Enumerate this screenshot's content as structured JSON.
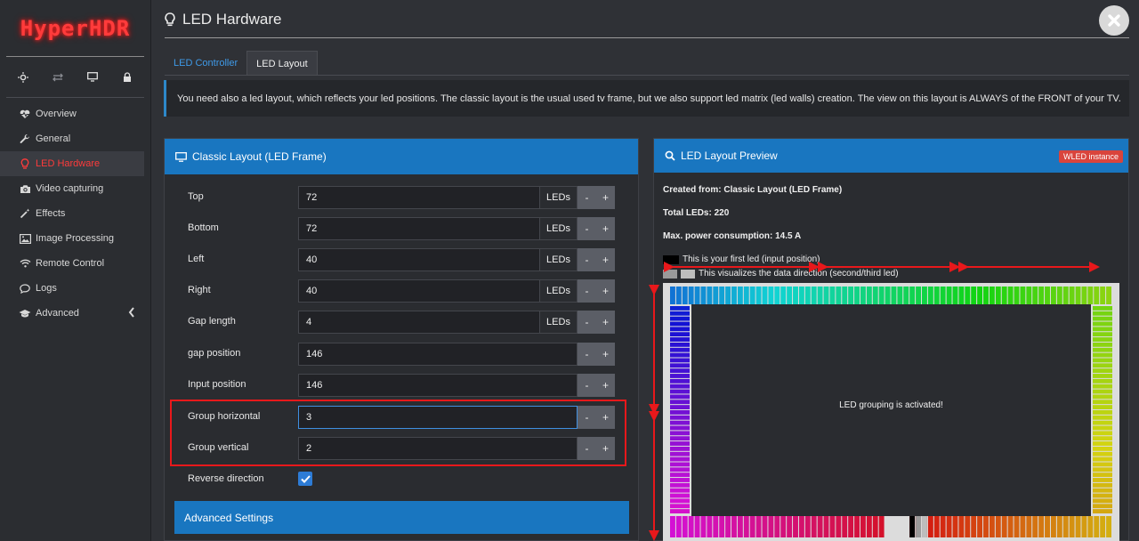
{
  "app": {
    "logo_text": "HyperHDR"
  },
  "sidebar": {
    "top_icons": [
      "sun-icon",
      "exchange-icon",
      "monitor-icon",
      "lock-icon"
    ],
    "items": [
      {
        "label": "Overview",
        "icon": "heartbeat-icon"
      },
      {
        "label": "General",
        "icon": "wrench-icon"
      },
      {
        "label": "LED Hardware",
        "icon": "lightbulb-icon",
        "active": true
      },
      {
        "label": "Video capturing",
        "icon": "camera-icon"
      },
      {
        "label": "Effects",
        "icon": "magic-wand-icon"
      },
      {
        "label": "Image Processing",
        "icon": "image-icon"
      },
      {
        "label": "Remote Control",
        "icon": "wifi-icon"
      },
      {
        "label": "Logs",
        "icon": "chat-icon"
      },
      {
        "label": "Advanced",
        "icon": "graduation-cap-icon"
      }
    ]
  },
  "header": {
    "title": "LED Hardware"
  },
  "tabs": [
    {
      "label": "LED Controller",
      "active": false
    },
    {
      "label": "LED Layout",
      "active": true
    }
  ],
  "info_text": "You need also a led layout, which reflects your led positions. The classic layout is the usual used tv frame, but we also support led matrix (led walls) creation. The view on this layout is ALWAYS of the FRONT of your TV.",
  "classic_layout": {
    "title": "Classic Layout (LED Frame)",
    "fields": [
      {
        "label": "Top",
        "value": "72",
        "unit": "LEDs"
      },
      {
        "label": "Bottom",
        "value": "72",
        "unit": "LEDs"
      },
      {
        "label": "Left",
        "value": "40",
        "unit": "LEDs"
      },
      {
        "label": "Right",
        "value": "40",
        "unit": "LEDs"
      },
      {
        "label": "Gap length",
        "value": "4",
        "unit": "LEDs"
      },
      {
        "label": "gap position",
        "value": "146",
        "unit": ""
      },
      {
        "label": "Input position",
        "value": "146",
        "unit": ""
      },
      {
        "label": "Group horizontal",
        "value": "3",
        "unit": ""
      },
      {
        "label": "Group vertical",
        "value": "2",
        "unit": ""
      }
    ],
    "stepper_minus": "-",
    "stepper_plus": "+",
    "reverse_label": "Reverse direction",
    "reverse_checked": true,
    "advanced_label": "Advanced Settings"
  },
  "preview": {
    "title": "LED Layout Preview",
    "badge": "WLED instance",
    "created_from": "Created from: Classic Layout (LED Frame)",
    "total_leds": "Total LEDs: 220",
    "max_power": "Max. power consumption: 14.5 A",
    "legend_first": "This is your first led (input position)",
    "legend_direction": "This visualizes the data direction (second/third led)",
    "grouping_msg": "LED grouping is activated!"
  },
  "colors": {
    "accent_blue": "#1976c0",
    "active_red": "#ff3b3b",
    "annotation_red": "#e8181b",
    "badge_red": "#d9443c"
  }
}
